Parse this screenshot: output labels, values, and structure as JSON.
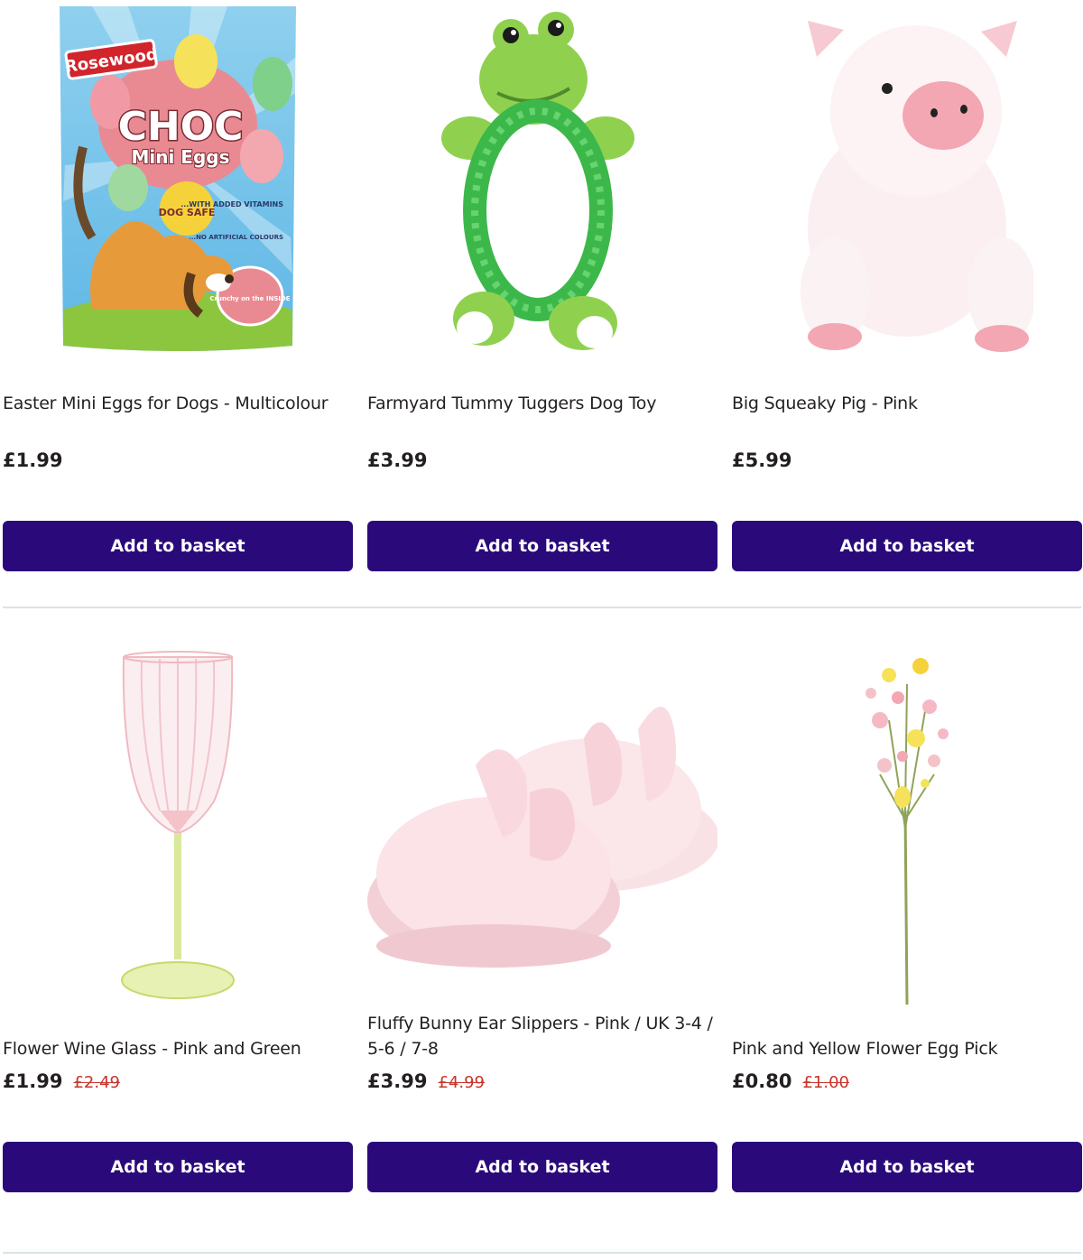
{
  "products": [
    {
      "name": "Easter Mini Eggs for Dogs - Multicolour",
      "price": "£1.99",
      "was": "",
      "button": "Add to basket",
      "image": "dog-treat-bag",
      "package_text": {
        "brand": "Rosewood",
        "big": "CHOC",
        "sub": "Mini Eggs",
        "badge": "DOG SAFE",
        "claim1": "...WITH ADDED VITAMINS",
        "claim2": "...NO ARTIFICIAL COLOURS",
        "claim3": "Crunchy on the INSIDE"
      }
    },
    {
      "name": "Farmyard Tummy Tuggers Dog Toy",
      "price": "£3.99",
      "was": "",
      "button": "Add to basket",
      "image": "frog-toy"
    },
    {
      "name": "Big Squeaky Pig - Pink",
      "price": "£5.99",
      "was": "",
      "button": "Add to basket",
      "image": "pig-plush"
    },
    {
      "name": "Flower Wine Glass - Pink and Green",
      "price": "£1.99",
      "was": "£2.49",
      "button": "Add to basket",
      "image": "wine-glass"
    },
    {
      "name": "Fluffy Bunny Ear Slippers - Pink / UK 3-4 / 5-6 / 7-8",
      "price": "£3.99",
      "was": "£4.99",
      "button": "Add to basket",
      "image": "bunny-slippers"
    },
    {
      "name": "Pink and Yellow Flower Egg Pick",
      "price": "£0.80",
      "was": "£1.00",
      "button": "Add to basket",
      "image": "flower-pick"
    }
  ],
  "colors": {
    "button": "#2a0a7a",
    "was_price": "#c8342b",
    "divider": "#d9e3e6"
  }
}
